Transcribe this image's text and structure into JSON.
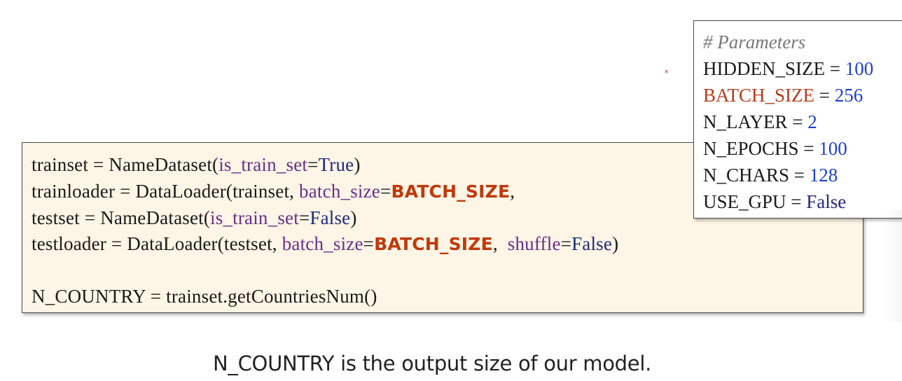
{
  "code": {
    "line1": {
      "a": "trainset = NameDataset(",
      "kw": "is_train_set",
      "eq": "=",
      "val": "True",
      "end": ")"
    },
    "line2": {
      "a": "trainloader = DataLoader(trainset, ",
      "kw": "batch_size",
      "eq": "=",
      "const": "BATCH_SIZE",
      "end": ","
    },
    "line3": {
      "a": "testset = NameDataset(",
      "kw": "is_train_set",
      "eq": "=",
      "val": "False",
      "end": ")"
    },
    "line4": {
      "a": "testloader = DataLoader(testset, ",
      "kw": "batch_size",
      "eq": "=",
      "const": "BATCH_SIZE",
      "sep": ",  ",
      "kw2": "shuffle",
      "eq2": "=",
      "val": "False",
      "end": ")"
    },
    "line5": "N_COUNTRY = trainset.getCountriesNum()"
  },
  "params": {
    "comment": "# Parameters",
    "items": [
      {
        "name": "HIDDEN_SIZE",
        "eq": " = ",
        "value": "100"
      },
      {
        "name": "BATCH_SIZE",
        "eq": " = ",
        "value": "256"
      },
      {
        "name": "N_LAYER",
        "eq": " = ",
        "value": "2"
      },
      {
        "name": "N_EPOCHS",
        "eq": " = ",
        "value": "100"
      },
      {
        "name": "N_CHARS",
        "eq": " = ",
        "value": "128"
      },
      {
        "name": "USE_GPU",
        "eq": " = ",
        "value": "False"
      }
    ]
  },
  "caption": "N_COUNTRY is the output size of our model.",
  "stray_mark": "×",
  "colors": {
    "code_background": "#fdf5e6",
    "keyword_arg": "#6a2f8a",
    "boolean": "#1f2a7a",
    "batch_size_constant": "#c0390b",
    "number": "#1f3fd6",
    "comment": "#777777"
  }
}
